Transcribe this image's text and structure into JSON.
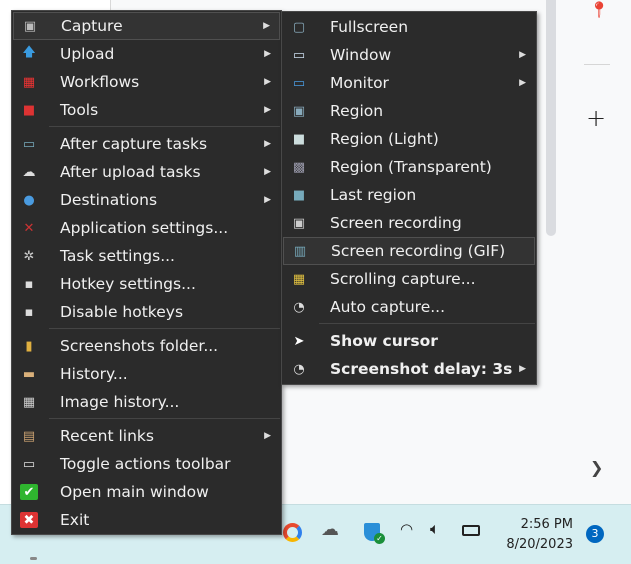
{
  "main_menu": {
    "sections": [
      [
        {
          "label": "Capture",
          "icon": "camera-icon",
          "submenu": true,
          "highlighted": true
        },
        {
          "label": "Upload",
          "icon": "upload-arrow-icon",
          "submenu": true
        },
        {
          "label": "Workflows",
          "icon": "workflows-grid-icon",
          "submenu": true
        },
        {
          "label": "Tools",
          "icon": "toolbox-icon",
          "submenu": true
        }
      ],
      [
        {
          "label": "After capture tasks",
          "icon": "image-arrow-icon",
          "submenu": true
        },
        {
          "label": "After upload tasks",
          "icon": "cloud-upload-icon",
          "submenu": true
        },
        {
          "label": "Destinations",
          "icon": "destinations-icon",
          "submenu": true
        },
        {
          "label": "Application settings...",
          "icon": "wrench-icon"
        },
        {
          "label": "Task settings...",
          "icon": "gear-icon"
        },
        {
          "label": "Hotkey settings...",
          "icon": "keyboard-key-icon"
        },
        {
          "label": "Disable hotkeys",
          "icon": "disable-key-icon"
        }
      ],
      [
        {
          "label": "Screenshots folder...",
          "icon": "folder-icon"
        },
        {
          "label": "History...",
          "icon": "history-icon"
        },
        {
          "label": "Image history...",
          "icon": "image-history-icon"
        }
      ],
      [
        {
          "label": "Recent links",
          "icon": "clipboard-icon",
          "submenu": true
        },
        {
          "label": "Toggle actions toolbar",
          "icon": "toolbar-icon"
        },
        {
          "label": "Open main window",
          "icon": "checkmark-icon"
        },
        {
          "label": "Exit",
          "icon": "close-icon"
        }
      ]
    ]
  },
  "capture_menu": {
    "items": [
      {
        "label": "Fullscreen",
        "icon": "fullscreen-icon"
      },
      {
        "label": "Window",
        "icon": "window-icon",
        "submenu": true
      },
      {
        "label": "Monitor",
        "icon": "monitor-icon",
        "submenu": true
      },
      {
        "label": "Region",
        "icon": "region-icon"
      },
      {
        "label": "Region (Light)",
        "icon": "region-light-icon"
      },
      {
        "label": "Region (Transparent)",
        "icon": "region-transparent-icon"
      },
      {
        "label": "Last region",
        "icon": "last-region-icon"
      },
      {
        "label": "Screen recording",
        "icon": "screen-recording-icon"
      },
      {
        "label": "Screen recording (GIF)",
        "icon": "film-icon",
        "highlighted": true
      },
      {
        "label": "Scrolling capture...",
        "icon": "scrolling-capture-icon"
      },
      {
        "label": "Auto capture...",
        "icon": "clock-icon"
      }
    ],
    "options": [
      {
        "label": "Show cursor",
        "icon": "cursor-icon"
      },
      {
        "label": "Screenshot delay: 3s",
        "icon": "clock-icon",
        "submenu": true
      }
    ]
  },
  "taskbar": {
    "time": "2:56 PM",
    "date": "8/20/2023",
    "notification_count": "3"
  },
  "colors": {
    "menu_bg": "#2b2b2b",
    "taskbar_bg": "#d6eef1",
    "badge": "#0067c0"
  }
}
